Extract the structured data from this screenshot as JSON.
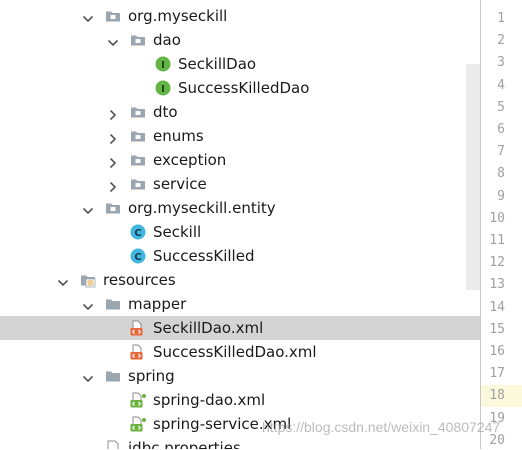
{
  "project_tree": {
    "items": [
      {
        "label": "org.myseckill",
        "icon": "package-icon",
        "arrow": "down"
      },
      {
        "label": "dao",
        "icon": "package-icon",
        "arrow": "down"
      },
      {
        "label": "SeckillDao",
        "icon": "interface-icon",
        "badge": "I"
      },
      {
        "label": "SuccessKilledDao",
        "icon": "interface-icon",
        "badge": "I"
      },
      {
        "label": "dto",
        "icon": "package-icon",
        "arrow": "right"
      },
      {
        "label": "enums",
        "icon": "package-icon",
        "arrow": "right"
      },
      {
        "label": "exception",
        "icon": "package-icon",
        "arrow": "right"
      },
      {
        "label": "service",
        "icon": "package-icon",
        "arrow": "right"
      },
      {
        "label": "org.myseckill.entity",
        "icon": "package-icon",
        "arrow": "down"
      },
      {
        "label": "Seckill",
        "icon": "class-icon",
        "badge": "C"
      },
      {
        "label": "SuccessKilled",
        "icon": "class-icon",
        "badge": "C"
      },
      {
        "label": "resources",
        "icon": "resources-folder-icon",
        "arrow": "down"
      },
      {
        "label": "mapper",
        "icon": "folder-icon",
        "arrow": "down"
      },
      {
        "label": "SeckillDao.xml",
        "icon": "xml-file-icon",
        "selected": true
      },
      {
        "label": "SuccessKilledDao.xml",
        "icon": "xml-file-icon"
      },
      {
        "label": "spring",
        "icon": "folder-icon",
        "arrow": "down"
      },
      {
        "label": "spring-dao.xml",
        "icon": "spring-xml-file-icon"
      },
      {
        "label": "spring-service.xml",
        "icon": "spring-xml-file-icon"
      },
      {
        "label": "jdbc.properties",
        "icon": "properties-file-icon"
      }
    ]
  },
  "gutter": {
    "line_numbers": [
      "1",
      "2",
      "3",
      "4",
      "5",
      "6",
      "7",
      "8",
      "9",
      "10",
      "11",
      "12",
      "13",
      "14",
      "15",
      "16",
      "17",
      "18",
      "19",
      "20"
    ],
    "current_line": "18"
  },
  "watermark": {
    "text": "https://blog.csdn.net/weixin_40807247"
  },
  "colors": {
    "selection": "#d4d4d4",
    "interface_badge": "#62b543",
    "class_badge": "#40b6e0",
    "xml_icon": "#e8683a",
    "spring_icon": "#6db33f",
    "folder": "#9aa7b0",
    "current_line_bg": "#fcf8dc"
  }
}
